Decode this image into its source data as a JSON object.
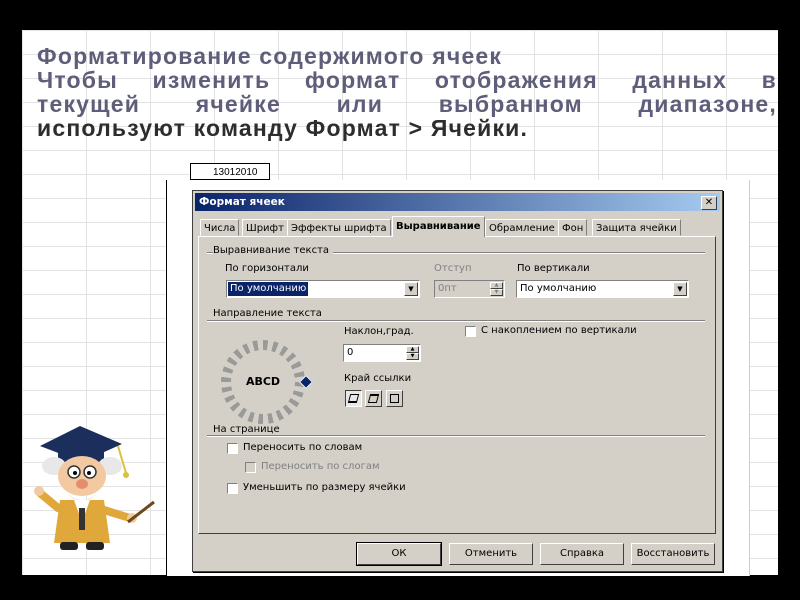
{
  "slide": {
    "title_line1": "Форматирование  содержимого  ячеек",
    "title_line2": "Чтобы  изменить  формат  отображения  данных  в",
    "title_line3": "текущей  ячейке  или  выбранном  диапазоне,",
    "title_line4": "используют  команду  Формат  >  Ячейки."
  },
  "cell_reference": "13012010",
  "dialog": {
    "title": "Формат ячеек",
    "close_glyph": "✕",
    "tabs": [
      "Числа",
      "Шрифт",
      "Эффекты шрифта",
      "Выравнивание",
      "Обрамление",
      "Фон",
      "Защита ячейки"
    ],
    "active_tab": "Выравнивание",
    "text_alignment": {
      "group_label": "Выравнивание текста",
      "horizontal_label": "По горизонтали",
      "horizontal_value": "По умолчанию",
      "indent_label": "Отступ",
      "indent_value": "0пт",
      "vertical_label": "По вертикали",
      "vertical_value": "По умолчанию"
    },
    "text_direction": {
      "group_label": "Направление текста",
      "dial_text": "ABCD",
      "angle_label": "Наклон,град.",
      "angle_value": "0",
      "stacked_label": "С накоплением по вертикали",
      "reference_edge_label": "Край ссылки"
    },
    "on_page": {
      "group_label": "На странице",
      "wrap_words_label": "Переносить по словам",
      "hyphenation_label": "Переносить по слогам",
      "shrink_label": "Уменьшить по размеру ячейки"
    },
    "buttons": {
      "ok": "ОК",
      "cancel": "Отменить",
      "help": "Справка",
      "reset": "Восстановить"
    }
  },
  "colors": {
    "title_text": "#5e5e7a",
    "titlebar_start": "#0a246a",
    "titlebar_end": "#a6caf0",
    "dialog_face": "#d4d0c8"
  }
}
